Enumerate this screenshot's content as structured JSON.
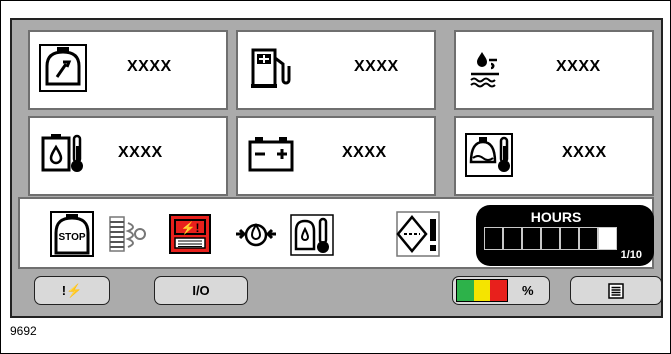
{
  "tiles": [
    {
      "icon": "engine-wrench-icon",
      "value": "XXXX"
    },
    {
      "icon": "fuel-pump-icon",
      "value": "XXXX"
    },
    {
      "icon": "coolant-level-icon",
      "value": "XXXX"
    },
    {
      "icon": "fuel-temperature-icon",
      "value": "XXXX"
    },
    {
      "icon": "battery-icon",
      "value": "XXXX"
    },
    {
      "icon": "oil-temperature-icon",
      "value": "XXXX"
    }
  ],
  "status": {
    "stop_label": "STOP",
    "icons": [
      "stop-engine-icon",
      "air-filter-icon",
      "control-panel-alarm-icon",
      "oil-pressure-icon",
      "oil-temperature-icon",
      "service-warning-icon"
    ],
    "alarm_color": "#e8201c",
    "panel_symbol": "⚡!",
    "hours": {
      "title": "HOURS",
      "page": "1/10",
      "filled_segments": 1,
      "segments": 7
    }
  },
  "buttons": {
    "fault_label": "!⚡",
    "io_label": "I/O",
    "percent_label": "%",
    "fuel_gauge_colors": [
      "#2db24a",
      "#f5e400",
      "#e8201c"
    ]
  },
  "figure_number": "9692"
}
